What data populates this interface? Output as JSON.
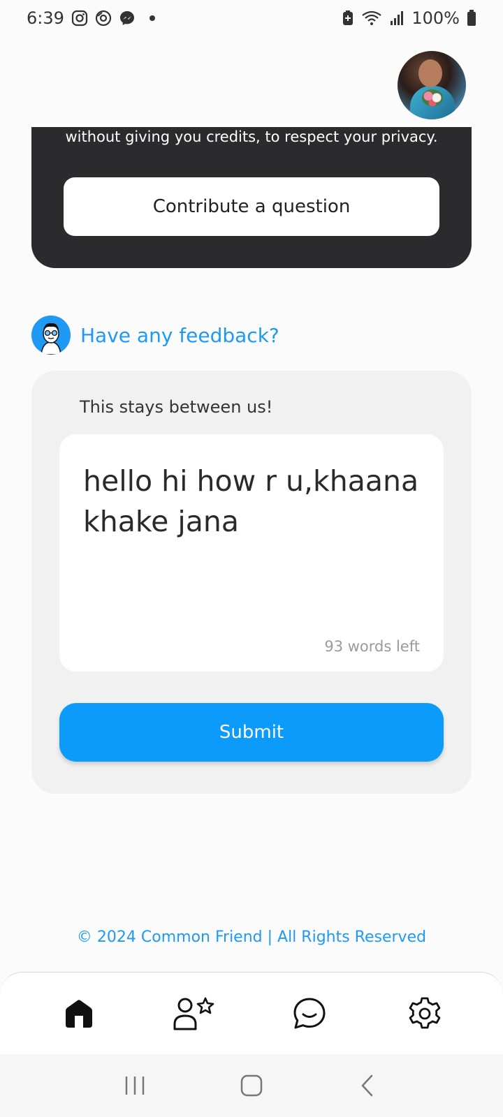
{
  "status_bar": {
    "time": "6:39",
    "battery": "100%",
    "left_icons": [
      "instagram-icon",
      "camera-app-icon",
      "messenger-icon"
    ],
    "right_icons": [
      "battery-saver-icon",
      "wifi-icon",
      "signal-icon",
      "battery-icon"
    ]
  },
  "header": {
    "avatar": "profile-avatar"
  },
  "contribute_card": {
    "text": "without giving you credits, to respect your privacy.",
    "button_label": "Contribute a question"
  },
  "feedback": {
    "title": "Have any feedback?",
    "subtitle": "This stays between us!",
    "input_value": "hello hi how r u,khaana khake jana",
    "words_left": "93 words left",
    "submit_label": "Submit"
  },
  "footer": {
    "copyright": "© 2024 Common Friend | All Rights Reserved"
  },
  "bottom_nav": {
    "items": [
      {
        "icon": "home-icon",
        "active": true
      },
      {
        "icon": "user-star-icon",
        "active": false
      },
      {
        "icon": "chat-icon",
        "active": false
      },
      {
        "icon": "gear-icon",
        "active": false
      }
    ]
  },
  "system_nav": {
    "items": [
      "recent-apps-icon",
      "home-circle-icon",
      "back-icon"
    ]
  },
  "colors": {
    "accent": "#0d9bfb",
    "link": "#1e9af5",
    "dark_card": "#2b2b2d",
    "card_bg": "#f1f1f1"
  }
}
